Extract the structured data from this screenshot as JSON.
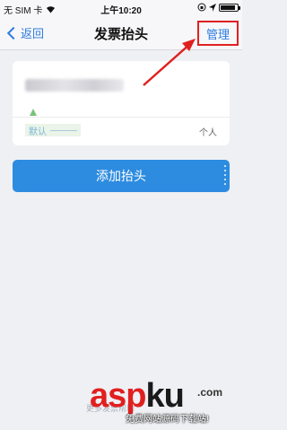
{
  "status_bar": {
    "carrier": "无 SIM 卡",
    "time": "上午10:20"
  },
  "nav": {
    "back_label": "返回",
    "title": "发票抬头",
    "manage_label": "管理"
  },
  "header_card": {
    "default_badge": "默认",
    "type_label": "个人"
  },
  "add_button_label": "添加抬头",
  "footer_text": "更多发票帮助",
  "watermark": {
    "brand_asp": "asp",
    "brand_ku": "ku",
    "domain": ".com",
    "tagline": "免费网站源码下载站!"
  },
  "colors": {
    "accent": "#2e8ce0",
    "annotation": "#e02020"
  }
}
